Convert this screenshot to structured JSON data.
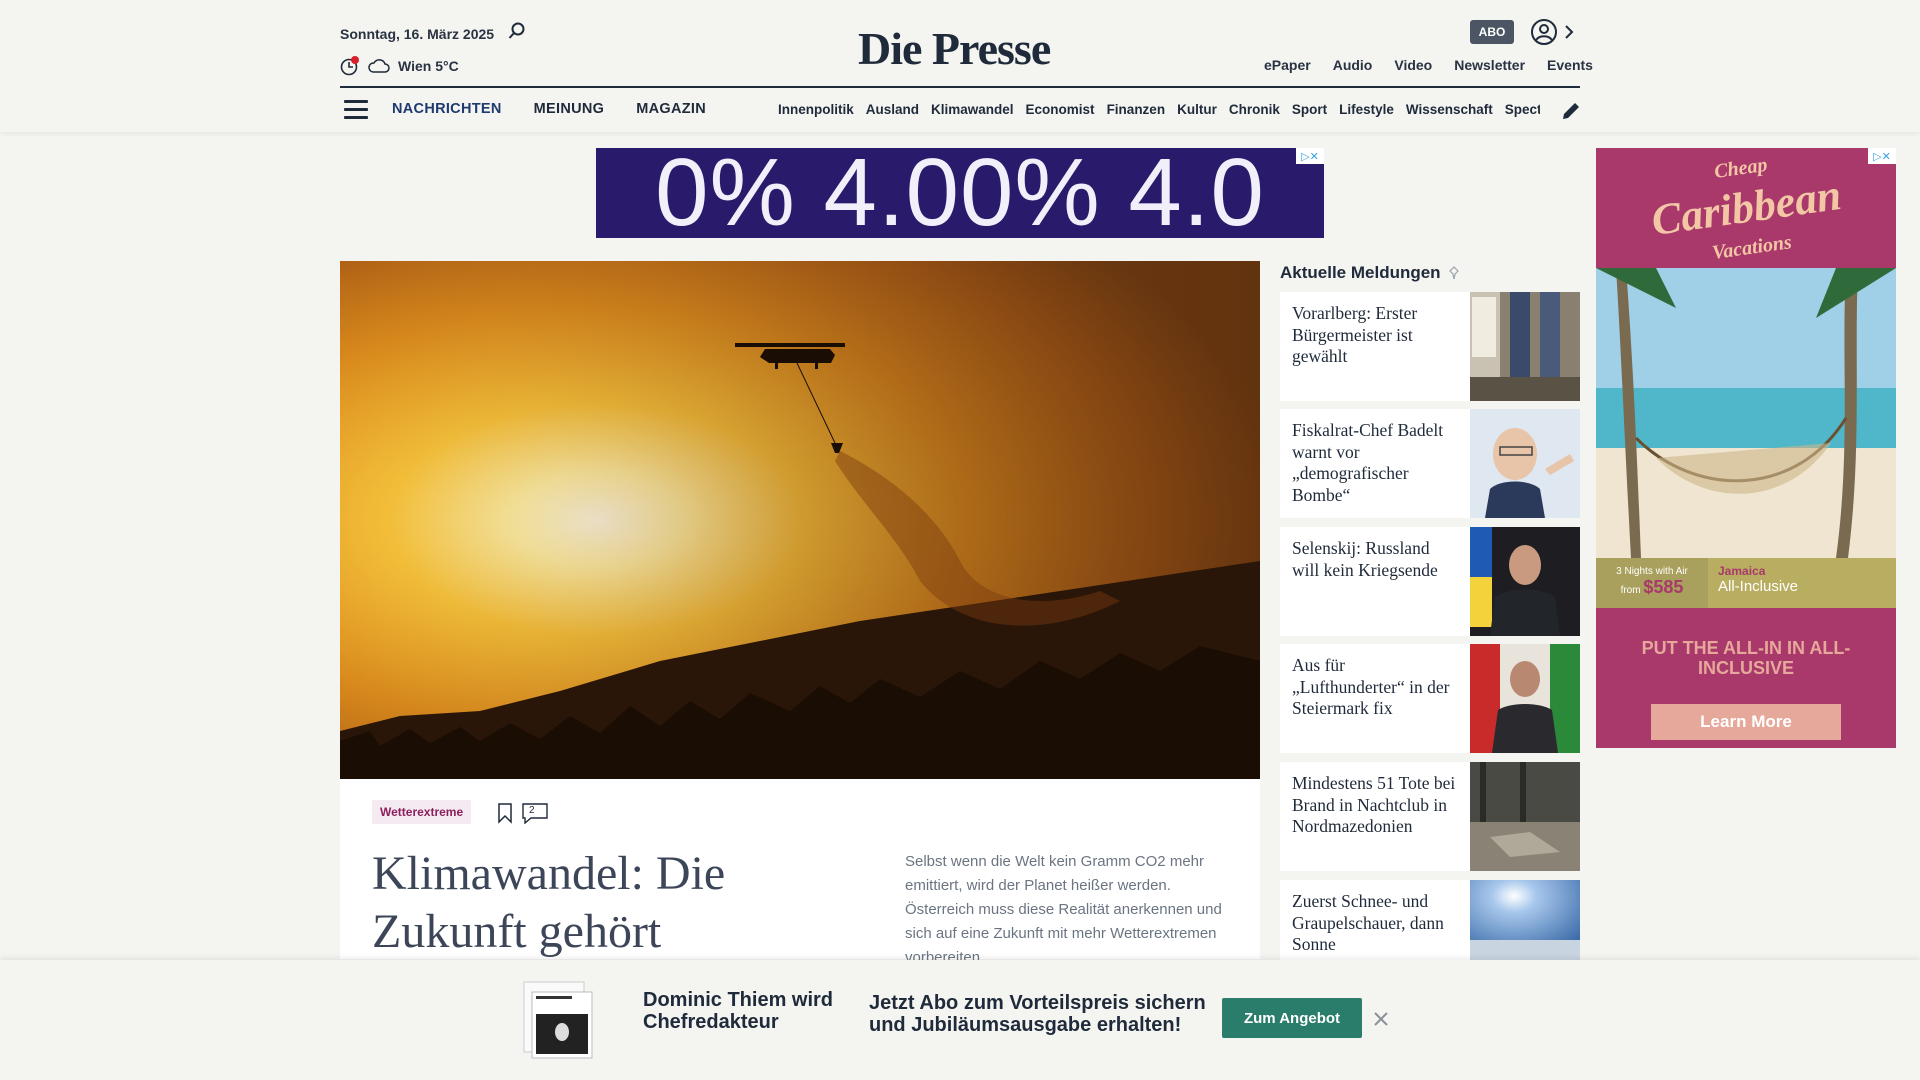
{
  "header": {
    "date": "Sonntag, 16. März 2025",
    "weather": "Wien 5°C",
    "logo": "Die Presse",
    "abo": "ABO",
    "toplinks": [
      "ePaper",
      "Audio",
      "Video",
      "Newsletter",
      "Events"
    ]
  },
  "nav": {
    "main": [
      "NACHRICHTEN",
      "MEINUNG",
      "MAGAZIN"
    ],
    "sub": [
      "Innenpolitik",
      "Ausland",
      "Klimawandel",
      "Economist",
      "Finanzen",
      "Kultur",
      "Chronik",
      "Sport",
      "Lifestyle",
      "Wissenschaft",
      "Spectrum"
    ]
  },
  "banner_ad": {
    "text": "0% 4.00% 4.0"
  },
  "hero": {
    "tag": "Wetterextreme",
    "comment_count": "2",
    "headline": "Klimawandel: Die Zukunft gehört",
    "teaser": "Selbst wenn die Welt kein Gramm CO2 mehr emittiert, wird der Planet heißer werden. Österreich muss diese Realität anerkennen und sich auf eine Zukunft mit mehr Wetterextremen vorbereiten."
  },
  "aktuell": {
    "title": "Aktuelle Meldungen",
    "items": [
      {
        "text": "Vorarlberg: Erster Bürgermeister ist gewählt"
      },
      {
        "text": "Fiskalrat-Chef Badelt warnt vor „demografischer Bombe“"
      },
      {
        "text": "Selenskij: Russland will kein Kriegsende"
      },
      {
        "text": "Aus für „Lufthunderter“ in der Steiermark fix"
      },
      {
        "text": "Mindestens 51 Tote bei Brand in Nachtclub in Nordmazedonien"
      },
      {
        "text": "Zuerst Schnee- und Graupelschauer, dann Sonne"
      }
    ]
  },
  "side_ad": {
    "title_top": "Cheap",
    "title_main": "Caribbean",
    "title_bottom": "Vacations",
    "nights": "3 Nights with Air",
    "from": "from",
    "price": "$585",
    "destination": "Jamaica",
    "type": "All-Inclusive",
    "cta": "PUT THE ALL-IN IN ALL-INCLUSIVE",
    "button": "Learn More"
  },
  "promo": {
    "headline": "Dominic Thiem wird Chefredakteur",
    "text": "Jetzt Abo zum Vorteilspreis sichern und Jubiläumsausgabe erhalten!",
    "button": "Zum Angebot"
  }
}
